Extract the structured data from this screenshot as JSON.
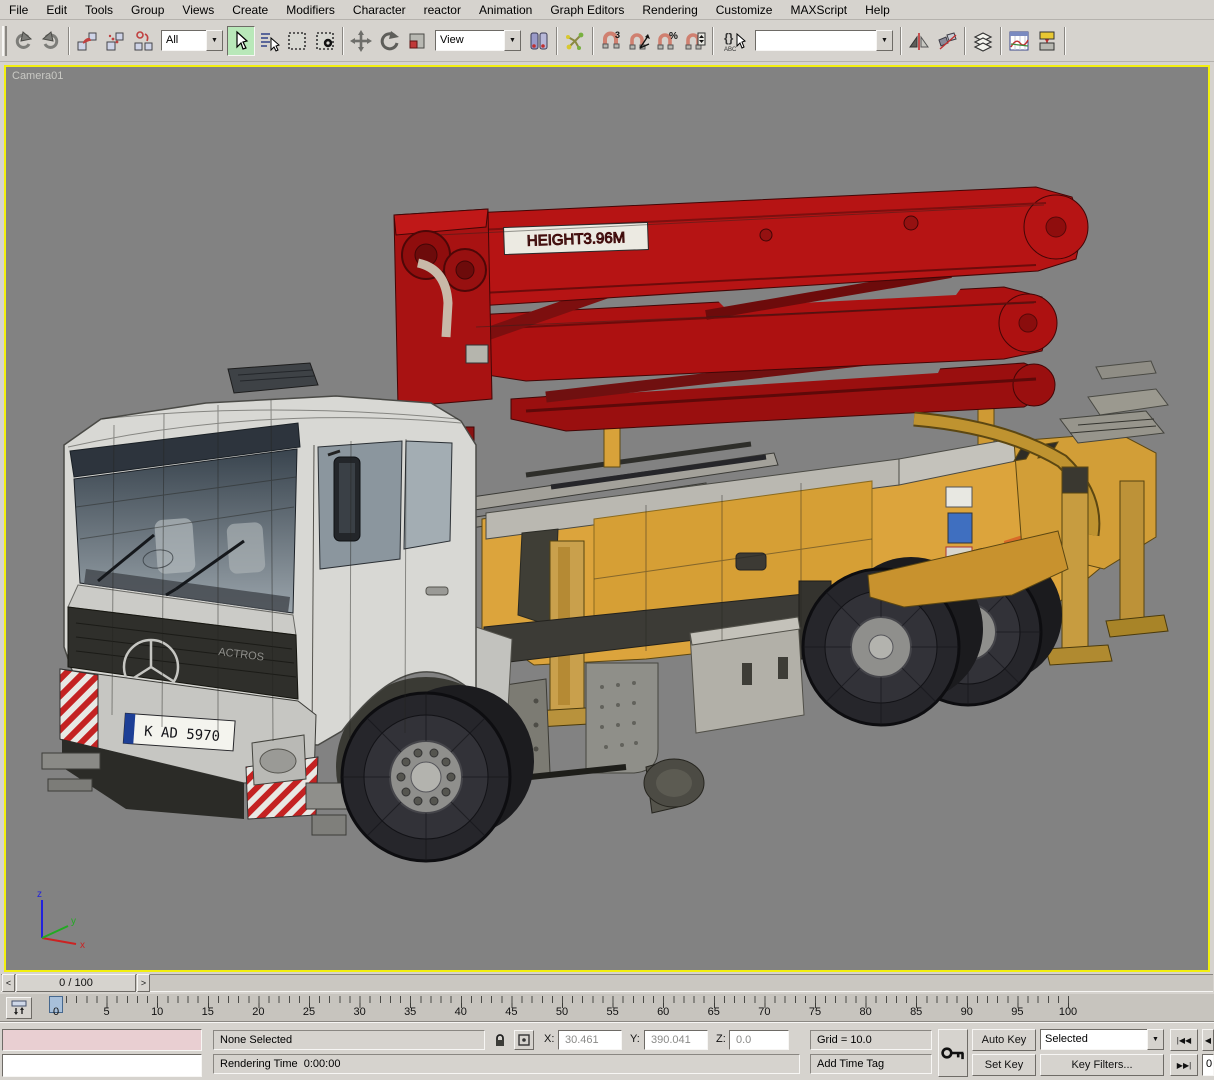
{
  "menu": {
    "items": [
      "File",
      "Edit",
      "Tools",
      "Group",
      "Views",
      "Create",
      "Modifiers",
      "Character",
      "reactor",
      "Animation",
      "Graph Editors",
      "Rendering",
      "Customize",
      "MAXScript",
      "Help"
    ]
  },
  "toolbar": {
    "selection_filter_value": "All",
    "coord_system_value": "View",
    "named_selection_value": "",
    "snap_badge": "3",
    "percent_badge": "%",
    "named_sets_text": "{}",
    "named_sets_sub": "ABC",
    "dropdown_arrow": "▼"
  },
  "viewport": {
    "label": "Camera01",
    "axis": {
      "x": "x",
      "y": "y",
      "z": "z"
    },
    "truck": {
      "boom_label": "HEIGHT3.96M",
      "license_plate": "K AD 5970",
      "brand_text": "ACTROS"
    }
  },
  "time_slider": {
    "prev": "<",
    "value": "0 / 100",
    "next": ">"
  },
  "trackbar": {
    "tick_labels": [
      "0",
      "5",
      "10",
      "15",
      "20",
      "25",
      "30",
      "35",
      "40",
      "45",
      "50",
      "55",
      "60",
      "65",
      "70",
      "75",
      "80",
      "85",
      "90",
      "95",
      "100"
    ]
  },
  "status_bar": {
    "selection_status": "None Selected",
    "x_label": "X:",
    "x_value": "30.461",
    "y_label": "Y:",
    "y_value": "390.041",
    "z_label": "Z:",
    "z_value": "0.0",
    "grid_text": "Grid = 10.0",
    "add_time_tag": "Add Time Tag",
    "rendering_time": "Rendering Time  0:00:00",
    "auto_key": "Auto Key",
    "set_key": "Set Key",
    "key_mode_value": "Selected",
    "key_filters": "Key Filters...",
    "frame_value": "0",
    "playback": {
      "go_start": "|◀◀",
      "prev_partial": "◀",
      "go_end": "▶▶|"
    }
  },
  "colors": {
    "ui_bg": "#d6d3ce",
    "viewport_bg": "#828282",
    "active_viewport_border": "#f2ef0e",
    "truck_red": "#b61414",
    "truck_yellow": "#dca43c",
    "cab_silver": "#d8d8d4",
    "hazard_red": "#c42222",
    "listener_pink": "#e9cfd2",
    "frame_marker_blue": "#a8c0da"
  }
}
